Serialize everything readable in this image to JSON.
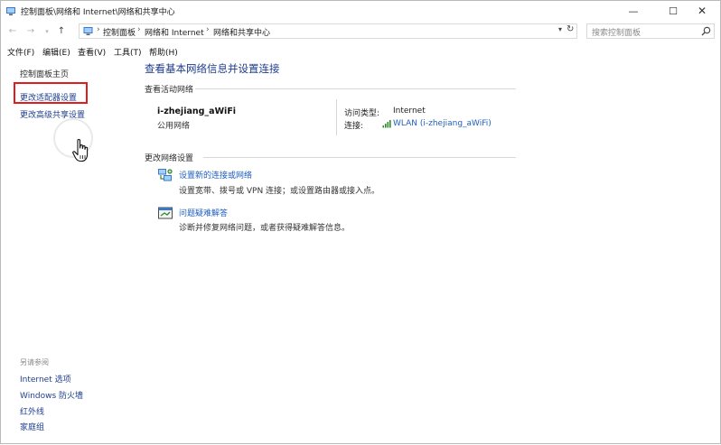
{
  "window": {
    "title": "控制面板\\网络和 Internet\\网络和共享中心",
    "minimize": "—",
    "maximize": "☐",
    "close": "✕"
  },
  "nav": {
    "back": "←",
    "forward": "→",
    "recent": "▾",
    "up": "↑"
  },
  "address": {
    "crumbs": [
      "控制面板",
      "网络和 Internet",
      "网络和共享中心"
    ],
    "separator": "›",
    "dropdown": "▾",
    "refresh": "↻"
  },
  "search": {
    "placeholder": "搜索控制面板"
  },
  "menu": [
    "文件(F)",
    "编辑(E)",
    "查看(V)",
    "工具(T)",
    "帮助(H)"
  ],
  "sidebar": {
    "home": "控制面板主页",
    "adapter": "更改适配器设置",
    "advanced": "更改高级共享设置",
    "see_also_title": "另请参阅",
    "see_also": [
      "Internet 选项",
      "Windows 防火墙",
      "红外线",
      "家庭组"
    ]
  },
  "main": {
    "title": "查看基本网络信息并设置连接",
    "active_section": "查看活动网络",
    "network_name": "i-zhejiang_aWiFi",
    "network_type": "公用网络",
    "access_type_label": "访问类型:",
    "access_type_value": "Internet",
    "connection_label": "连接:",
    "connection_value": "WLAN (i-zhejiang_aWiFi)",
    "change_section": "更改网络设置",
    "tasks": [
      {
        "link": "设置新的连接或网络",
        "desc": "设置宽带、拨号或 VPN 连接；或设置路由器或接入点。"
      },
      {
        "link": "问题疑难解答",
        "desc": "诊断并修复网络问题，或者获得疑难解答信息。"
      }
    ]
  },
  "colors": {
    "link": "#1f5fbf",
    "title_blue": "#1e3c8c",
    "highlight_red": "#e01c1c"
  }
}
